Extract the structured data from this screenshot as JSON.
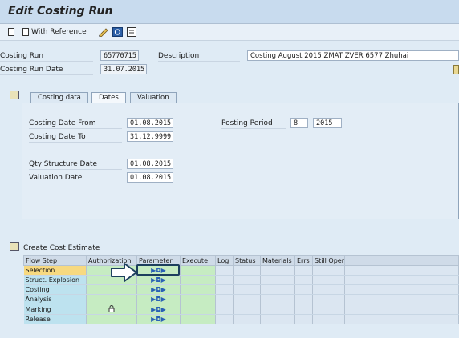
{
  "window": {
    "title": "Edit Costing Run"
  },
  "toolbar": {
    "with_reference_label": "With Reference"
  },
  "header": {
    "costing_run_label": "Costing Run",
    "costing_run_value": "65770715",
    "description_label": "Description",
    "description_value": "Costing August 2015 ZMAT ZVER 6577 Zhuhai",
    "run_date_label": "Costing Run Date",
    "run_date_value": "31.07.2015"
  },
  "tabs": [
    {
      "label": "Costing data"
    },
    {
      "label": "Dates"
    },
    {
      "label": "Valuation"
    }
  ],
  "dates": {
    "costing_date_from_label": "Costing Date From",
    "costing_date_from_value": "01.08.2015",
    "costing_date_to_label": "Costing Date To",
    "costing_date_to_value": "31.12.9999",
    "posting_period_label": "Posting Period",
    "posting_period_value": "8",
    "posting_year_value": "2015",
    "qty_structure_date_label": "Qty Structure Date",
    "qty_structure_date_value": "01.08.2015",
    "valuation_date_label": "Valuation Date",
    "valuation_date_value": "01.08.2015"
  },
  "cost_estimate": {
    "section_label": "Create Cost Estimate",
    "columns": [
      "Flow Step",
      "Authorization",
      "Parameter",
      "Execute",
      "Log",
      "Status",
      "Materials",
      "Errs",
      "Still Open"
    ],
    "steps": [
      "Selection",
      "Struct. Explosion",
      "Costing",
      "Analysis",
      "Marking",
      "Release"
    ],
    "parameter_icon": "parameter-icon",
    "marking_authorization_icon": "lock-icon"
  },
  "colors": {
    "selected_step": "#f7d980",
    "step_cell": "#bde2ef",
    "active_cell": "#c6ecc2",
    "highlight_border": "#1d3f5e"
  }
}
